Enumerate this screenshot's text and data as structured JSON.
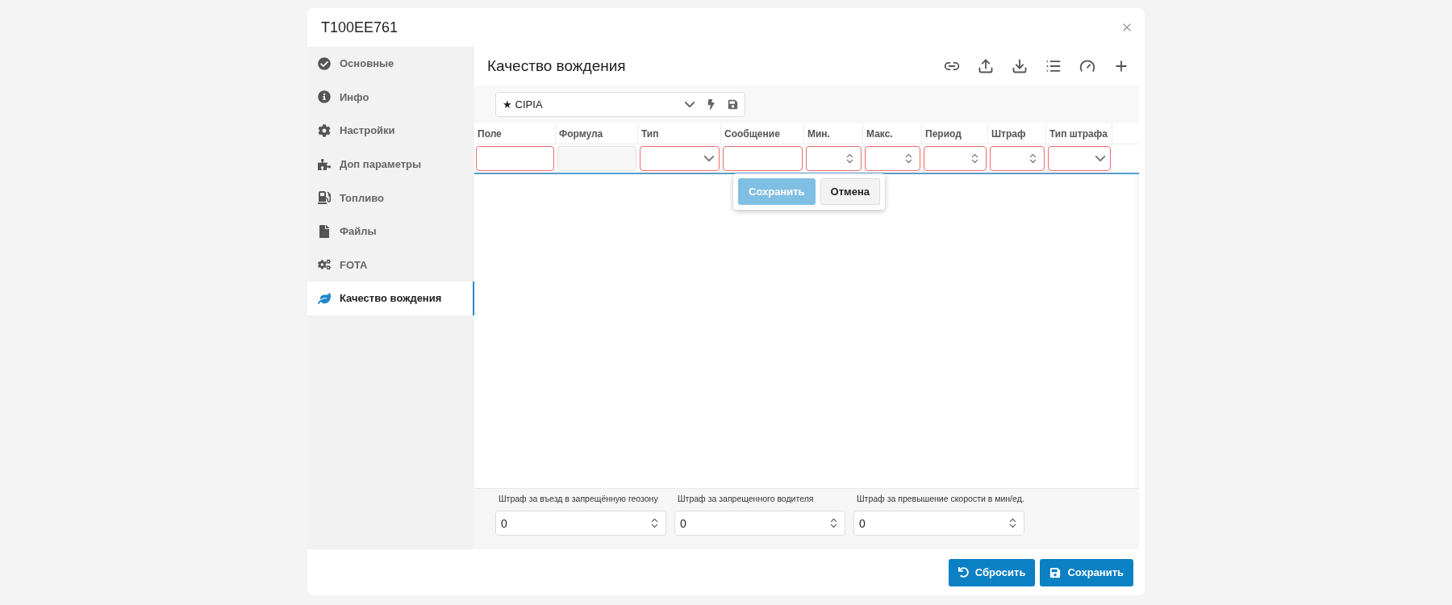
{
  "window": {
    "title": "T100EE761"
  },
  "sidebar": {
    "items": [
      {
        "label": "Основные",
        "selected": false
      },
      {
        "label": "Инфо",
        "selected": false
      },
      {
        "label": "Настройки",
        "selected": false
      },
      {
        "label": "Доп параметры",
        "selected": false
      },
      {
        "label": "Топливо",
        "selected": false
      },
      {
        "label": "Файлы",
        "selected": false
      },
      {
        "label": "FOTA",
        "selected": false
      },
      {
        "label": "Качество вождения",
        "selected": true
      }
    ]
  },
  "panel": {
    "title": "Качество вождения",
    "preset": "★ CIPIA"
  },
  "table": {
    "columns": [
      {
        "label": "Поле",
        "kind": "text",
        "invalid": true
      },
      {
        "label": "Формула",
        "kind": "disabled",
        "invalid": false
      },
      {
        "label": "Тип",
        "kind": "select",
        "invalid": true
      },
      {
        "label": "Сообщение",
        "kind": "text",
        "invalid": true
      },
      {
        "label": "Мин.",
        "kind": "number",
        "invalid": true
      },
      {
        "label": "Макс.",
        "kind": "number",
        "invalid": true
      },
      {
        "label": "Период",
        "kind": "number",
        "invalid": true
      },
      {
        "label": "Штраф",
        "kind": "number",
        "invalid": true
      },
      {
        "label": "Тип штрафа",
        "kind": "select",
        "invalid": true
      }
    ],
    "row_actions": [
      {
        "label": "Сохранить",
        "disabled": true
      },
      {
        "label": "Отмена",
        "disabled": false
      }
    ]
  },
  "penalties": [
    {
      "label": "Штраф за въезд в запрещённую геозону",
      "value": "0"
    },
    {
      "label": "Штраф за запрещенного водителя",
      "value": "0"
    },
    {
      "label": "Штраф за превышение скорости в мин/ед.",
      "value": "0"
    }
  ],
  "footer": {
    "reset": "Сбросить",
    "save": "Сохранить"
  }
}
